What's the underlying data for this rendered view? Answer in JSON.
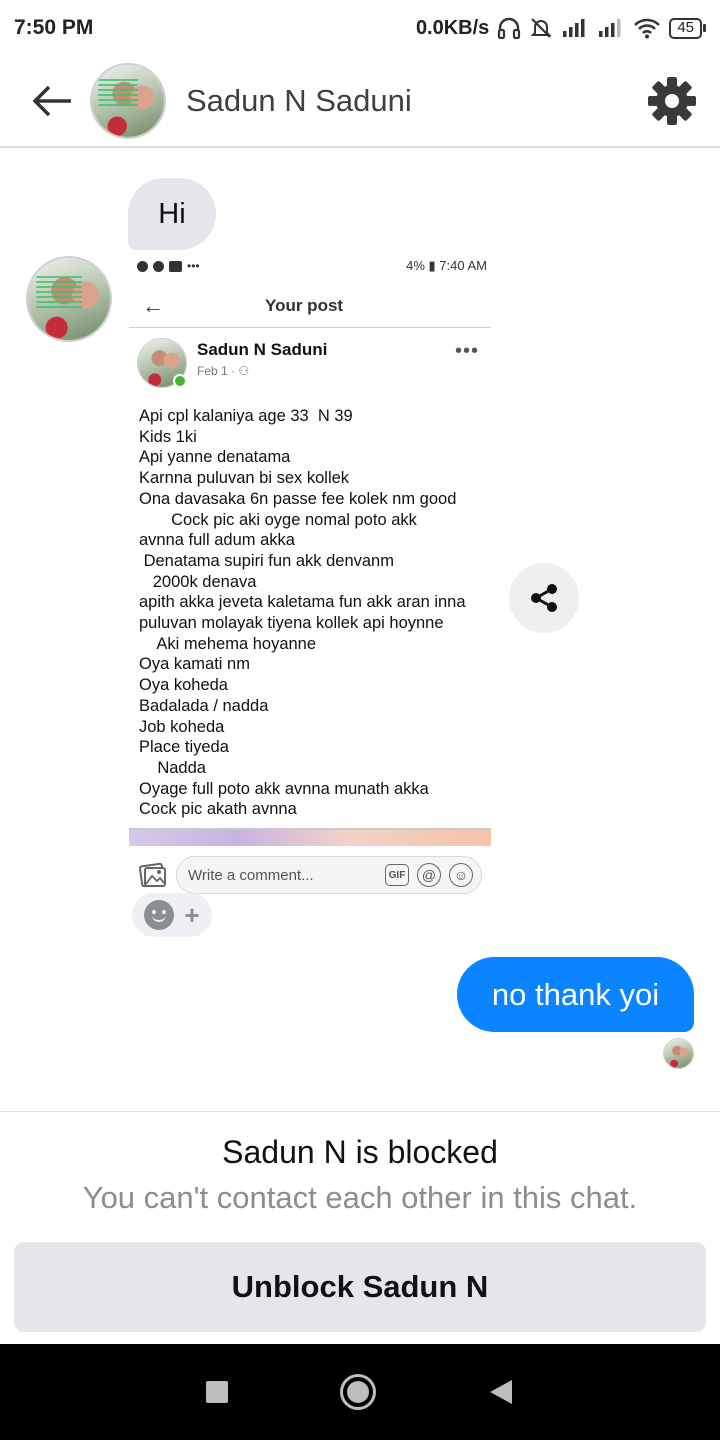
{
  "status_bar": {
    "time": "7:50 PM",
    "net_speed": "0.0KB/s",
    "battery": "45"
  },
  "header": {
    "title": "Sadun N Saduni",
    "icons": {
      "back": "arrow-left-icon",
      "settings": "gear-icon"
    }
  },
  "messages": {
    "incoming_text": "Hi",
    "outgoing_text": "no thank yoi"
  },
  "shared_screenshot": {
    "status_right": "4% ▮ 7:40 AM",
    "app_title": "Your post",
    "author": "Sadun N Saduni",
    "date": "Feb 1 · ⚇",
    "more": "•••",
    "body": "Api cpl kalaniya age 33  N 39\nKids 1ki\nApi yanne denatama\nKarnna puluvan bi sex kollek\nOna davasaka 6n passe fee kolek nm good\n       Cock pic aki oyge nomal poto akk\navnna full adum akka\n Denatama supiri fun akk denvanm\n   2000k denava\napith akka jeveta kaletama fun akk aran inna\npuluvan molayak tiyena kollek api hoynne\n    Aki mehema hoyanne\nOya kamati nm\nOya koheda\nBadalada / nadda\nJob koheda\nPlace tiyeda\n    Nadda\nOyage full poto akk avnna munath akka\nCock pic akath avnna",
    "comment_placeholder": "Write a comment...",
    "gif_label": "GIF"
  },
  "blocked": {
    "title": "Sadun N is blocked",
    "subtitle": "You can't contact each other in this chat.",
    "unblock_label": "Unblock Sadun N"
  },
  "colors": {
    "outgoing_bubble": "#0a84ff",
    "incoming_bubble": "#e4e6eb",
    "online": "#42b72a"
  }
}
